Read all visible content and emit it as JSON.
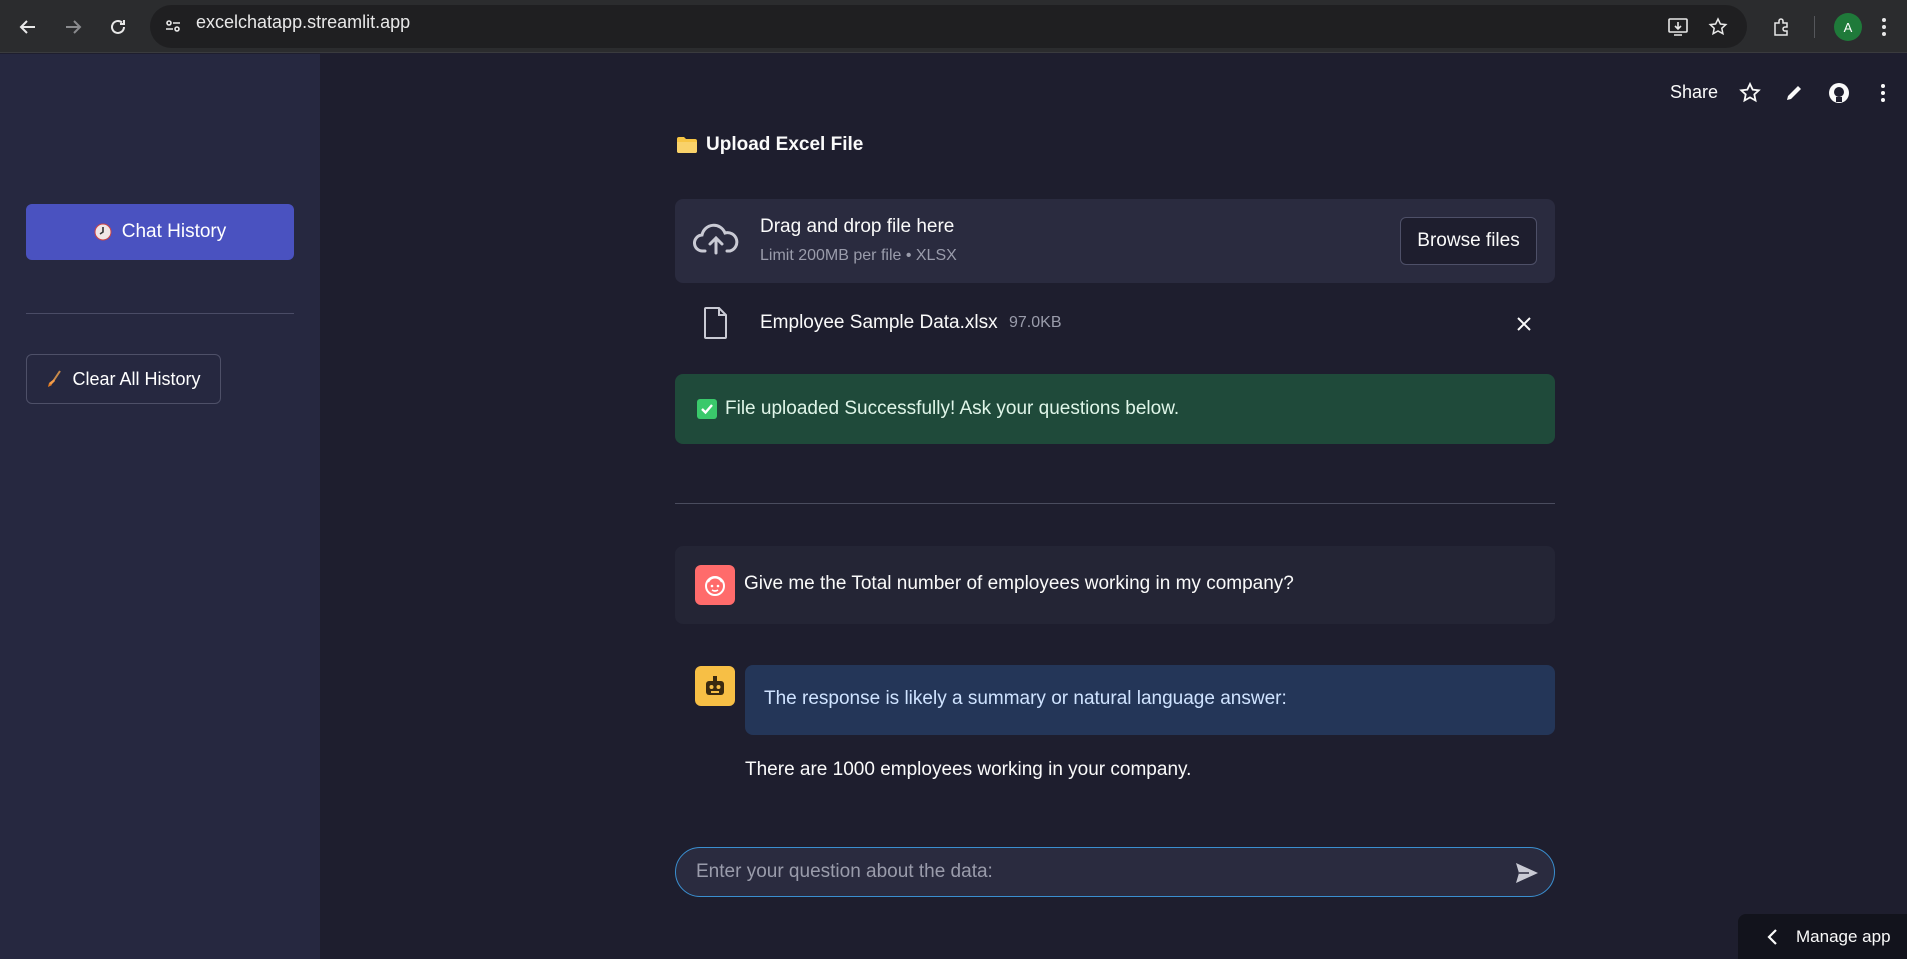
{
  "browser": {
    "url": "excelchatapp.streamlit.app",
    "profile_initial": "A"
  },
  "sidebar": {
    "chat_history_label": "Chat History",
    "clear_history_label": "Clear All History"
  },
  "toolbar": {
    "share_label": "Share"
  },
  "upload": {
    "title": "Upload Excel File",
    "drop_title": "Drag and drop file here",
    "drop_subtitle": "Limit 200MB per file • XLSX",
    "browse_label": "Browse files",
    "file_name": "Employee Sample Data.xlsx",
    "file_size": "97.0KB",
    "success_message": "File uploaded Successfully! Ask your questions below."
  },
  "chat": {
    "user_message": "Give me the Total number of employees working in my company?",
    "bot_bubble": "The response is likely a summary or natural language answer:",
    "bot_answer": "There are 1000 employees working in your company.",
    "input_placeholder": "Enter your question about the data:"
  },
  "footer": {
    "manage_app_label": "Manage app"
  },
  "colors": {
    "accent": "#4a52c0",
    "success_bg": "#1f4a3a",
    "user_avatar": "#ff6b6b",
    "bot_avatar": "#f7bf45",
    "input_border": "#3a8fd0"
  }
}
